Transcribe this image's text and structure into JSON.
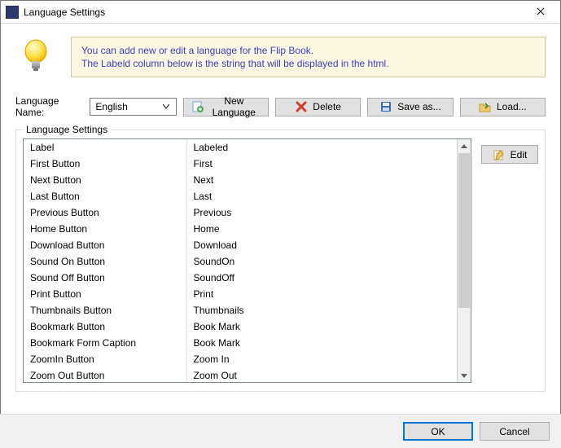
{
  "window": {
    "title": "Language Settings",
    "ok": "OK",
    "cancel": "Cancel"
  },
  "info": {
    "line1": "You can add new or edit  a language for the Flip Book.",
    "line2": "The Labeld column below is the string that will be displayed in the html."
  },
  "form": {
    "language_name_label": "Language Name:",
    "language_selected": "English"
  },
  "buttons": {
    "new_language": "New Language",
    "delete": "Delete",
    "save_as": "Save as...",
    "load": "Load...",
    "edit": "Edit"
  },
  "group": {
    "title": "Language Settings",
    "columns": {
      "label": "Label",
      "labeled": "Labeled"
    },
    "rows": [
      {
        "label": "First Button",
        "labeled": "First"
      },
      {
        "label": "Next Button",
        "labeled": "Next"
      },
      {
        "label": "Last Button",
        "labeled": "Last"
      },
      {
        "label": "Previous Button",
        "labeled": "Previous"
      },
      {
        "label": "Home Button",
        "labeled": "Home"
      },
      {
        "label": "Download Button",
        "labeled": "Download"
      },
      {
        "label": "Sound On Button",
        "labeled": "SoundOn"
      },
      {
        "label": "Sound Off Button",
        "labeled": "SoundOff"
      },
      {
        "label": "Print Button",
        "labeled": "Print"
      },
      {
        "label": "Thumbnails Button",
        "labeled": "Thumbnails"
      },
      {
        "label": "Bookmark Button",
        "labeled": "Book Mark"
      },
      {
        "label": "Bookmark Form Caption",
        "labeled": "Book Mark"
      },
      {
        "label": "ZoomIn Button",
        "labeled": "Zoom In"
      },
      {
        "label": "Zoom Out Button",
        "labeled": "Zoom Out"
      }
    ]
  }
}
